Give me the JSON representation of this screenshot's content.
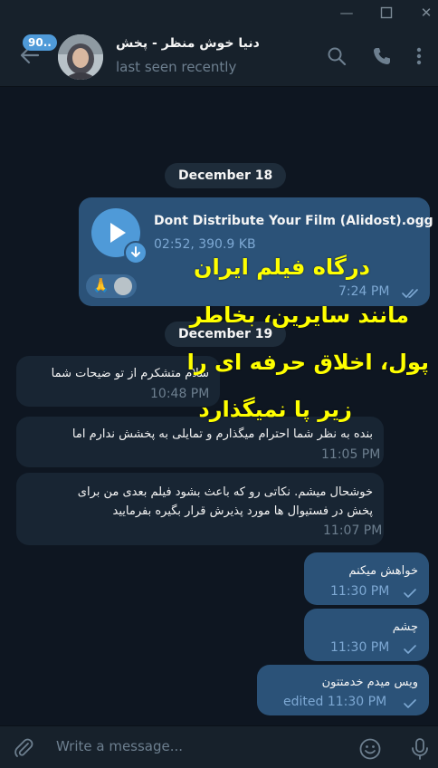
{
  "header": {
    "unread_badge": "90..",
    "contact_name": "دنیا خوش منظر - پخش",
    "status": "last seen recently"
  },
  "dates": [
    "December 18",
    "December 19"
  ],
  "voice_message": {
    "title": "Dont Distribute Your Film (Alidost).ogg",
    "meta": "02:52, 390.9 KB",
    "time": "7:24 PM",
    "reaction": "🙏"
  },
  "overlay_text": {
    "line1": "درگاه فیلم ایران",
    "line2": "مانند سایرین، بخاطر",
    "line3": "پول، اخلاق حرفه ای را",
    "line4": "زیر پا نمیگذارد"
  },
  "messages": [
    {
      "direction": "in",
      "text": "سلام متشکرم از تو ضیحات شما",
      "time": "10:48 PM"
    },
    {
      "direction": "in",
      "text": "بنده به نظر شما احترام میگذارم و تمایلی به پخشش ندارم اما",
      "time": "11:05 PM"
    },
    {
      "direction": "in",
      "text_line1": "خوشحال میشم. نکاتی رو که باعث بشود فیلم بعدی من برای",
      "text_line2": "پخش در فستیوال ها  مورد پذیرش قرار بگیره  بفرمایید",
      "time": "11:07 PM"
    },
    {
      "direction": "out",
      "text": "خواهش میکنم",
      "time": "11:30 PM"
    },
    {
      "direction": "out",
      "text": "چشم",
      "time": "11:30 PM"
    },
    {
      "direction": "out",
      "text": "ویس میدم خدمتتون",
      "time": "edited 11:30 PM"
    }
  ],
  "input": {
    "placeholder": "Write a message..."
  },
  "colors": {
    "background": "#0e1621",
    "header": "#17212b",
    "incoming_bubble": "#182533",
    "outgoing_bubble": "#2b5278",
    "accent": "#4f9ad8",
    "overlay_text": "#ffff00"
  }
}
